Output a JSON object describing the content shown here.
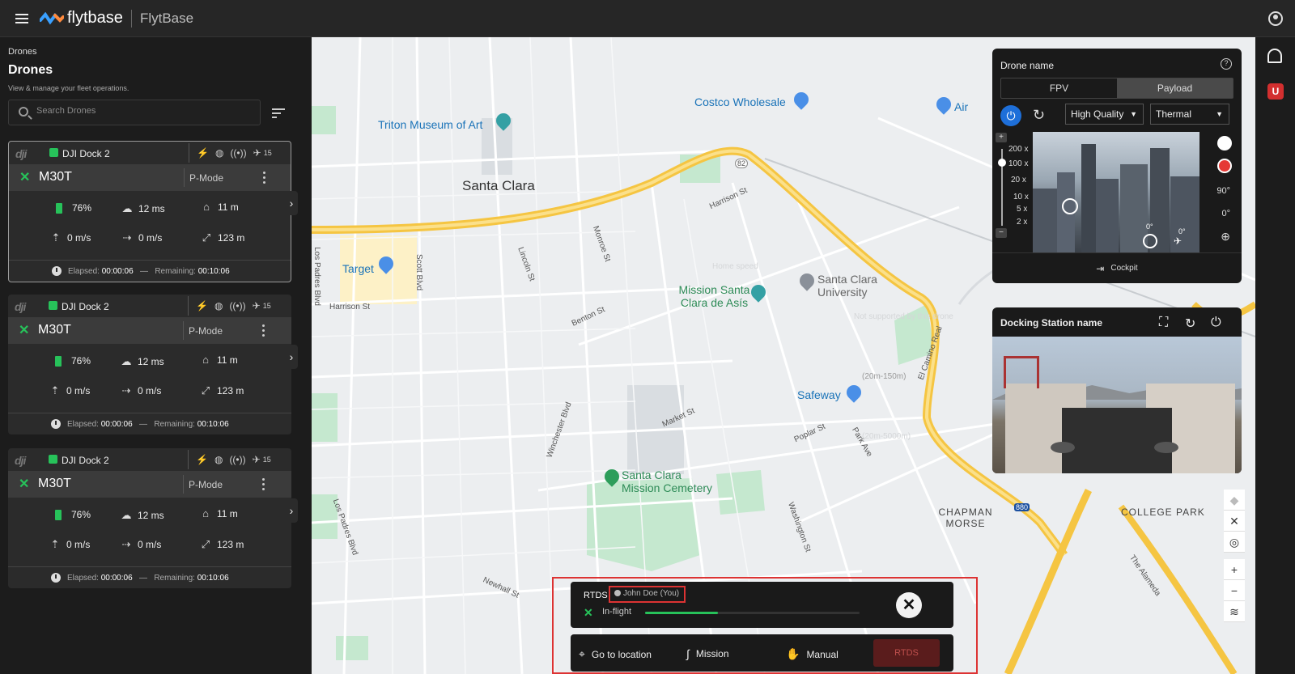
{
  "header": {
    "brand_word": "flytbase",
    "app_title": "FlytBase"
  },
  "sidebar": {
    "breadcrumb": "Drones",
    "title": "Drones",
    "subtitle": "View & manage your fleet operations.",
    "search_placeholder": "Search Drones",
    "cards": [
      {
        "dji": "dji",
        "dock": "DJI Dock 2",
        "sat": "15",
        "model": "M30T",
        "mode": "P-Mode",
        "battery": "76%",
        "latency": "12 ms",
        "home": "11 m",
        "vspeed": "0 m/s",
        "hspeed": "0 m/s",
        "alt": "123 m",
        "elapsed_label": "Elapsed:",
        "elapsed": "00:00:06",
        "dash": "—",
        "remaining_label": "Remaining:",
        "remaining": "00:10:06"
      },
      {
        "dji": "dji",
        "dock": "DJI Dock 2",
        "sat": "15",
        "model": "M30T",
        "mode": "P-Mode",
        "battery": "76%",
        "latency": "12 ms",
        "home": "11 m",
        "vspeed": "0 m/s",
        "hspeed": "0 m/s",
        "alt": "123 m",
        "elapsed_label": "Elapsed:",
        "elapsed": "00:00:06",
        "dash": "—",
        "remaining_label": "Remaining:",
        "remaining": "00:10:06"
      },
      {
        "dji": "dji",
        "dock": "DJI Dock 2",
        "sat": "15",
        "model": "M30T",
        "mode": "P-Mode",
        "battery": "76%",
        "latency": "12 ms",
        "home": "11 m",
        "vspeed": "0 m/s",
        "hspeed": "0 m/s",
        "alt": "123 m",
        "elapsed_label": "Elapsed:",
        "elapsed": "00:00:06",
        "dash": "—",
        "remaining_label": "Remaining:",
        "remaining": "00:10:06"
      }
    ]
  },
  "map": {
    "labels": {
      "costco": "Costco Wholesale",
      "triton": "Triton Museum of Art",
      "santa_clara": "Santa Clara",
      "target": "Target",
      "mission": "Mission Santa Clara de Asís",
      "scu": "Santa Clara University",
      "safeway": "Safeway",
      "cemetery": "Santa Clara Mission Cemetery",
      "chapman": "CHAPMAN MORSE",
      "college": "COLLEGE PARK",
      "airport": "Air",
      "harrison": "Harrison St",
      "harrison2": "Harrison St",
      "los_padres": "Los Padres Blvd",
      "los_padres2": "Los Padres Blvd",
      "scott": "Scott Blvd",
      "lincoln": "Lincoln St",
      "monroe": "Monroe St",
      "benton": "Benton St",
      "winchester": "Winchester Blvd",
      "market": "Market St",
      "poplar": "Poplar St",
      "park": "Park Ave",
      "washington": "Washington St",
      "newhall": "Newhall St",
      "el_camino": "El Camino Real",
      "alameda": "The Alameda",
      "hwy82": "82",
      "hwy880": "880",
      "not_supported": "Not supported by this drone",
      "range1": "(20m-150m)",
      "range2": "(20m-5000m)",
      "home_speed": "Home speed"
    }
  },
  "drone_panel": {
    "title": "Drone name",
    "help": "?",
    "tab_fpv": "FPV",
    "tab_payload": "Payload",
    "quality": "High Quality",
    "lens": "Thermal",
    "zoom_plus": "+",
    "zoom_minus": "−",
    "zoom_levels": [
      "200 x",
      "100 x",
      "20 x",
      "10 x",
      "5 x",
      "2 x"
    ],
    "gimbal_90": "90°",
    "gimbal_0": "0°",
    "cam_0a": "0°",
    "cam_0b": "0°",
    "cockpit": "Cockpit"
  },
  "dock_panel": {
    "title": "Docking Station name"
  },
  "rtds": {
    "name": "RTDS",
    "user": "John Doe (You)",
    "status": "In-flight",
    "progress": 0.34
  },
  "actions": {
    "goto": "Go to location",
    "mission": "Mission",
    "manual": "Manual",
    "rtds": "RTDS"
  },
  "colors": {
    "accent_green": "#27c25a",
    "primary_blue": "#1e6fd9",
    "alert_red": "#d33333",
    "road_yellow": "#f5c542"
  }
}
